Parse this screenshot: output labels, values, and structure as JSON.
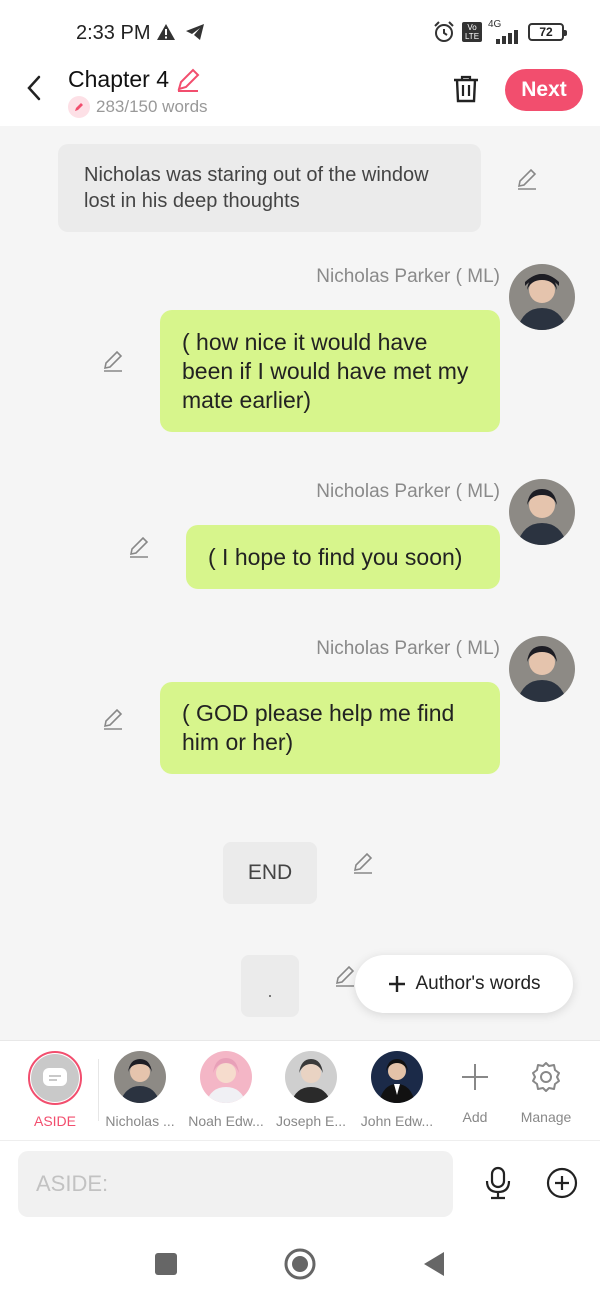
{
  "status_bar": {
    "time": "2:33 PM",
    "network": "4G",
    "volte": "Vo LTE",
    "battery": "72"
  },
  "header": {
    "title": "Chapter 4",
    "word_count": "283/150 words",
    "next_label": "Next"
  },
  "messages": {
    "narration": "Nicholas was staring out of the window lost in his deep thoughts",
    "m1": {
      "speaker": "Nicholas Parker ( ML)",
      "text": "( how nice it would have been if I would have met my mate earlier)"
    },
    "m2": {
      "speaker": "Nicholas Parker ( ML)",
      "text": "( I hope to find you soon)"
    },
    "m3": {
      "speaker": "Nicholas Parker ( ML)",
      "text": "( GOD please help me find him or her)"
    },
    "end_label": "END",
    "dot_label": "."
  },
  "authors_words_label": "Author's words",
  "characters": {
    "aside": "ASIDE",
    "c1": "Nicholas ...",
    "c2": "Noah Edw...",
    "c3": "Joseph E...",
    "c4": "John Edw...",
    "add": "Add",
    "manage": "Manage"
  },
  "input": {
    "placeholder": "ASIDE:"
  },
  "colors": {
    "accent": "#f24e6e",
    "bubble": "#d7f58c"
  }
}
